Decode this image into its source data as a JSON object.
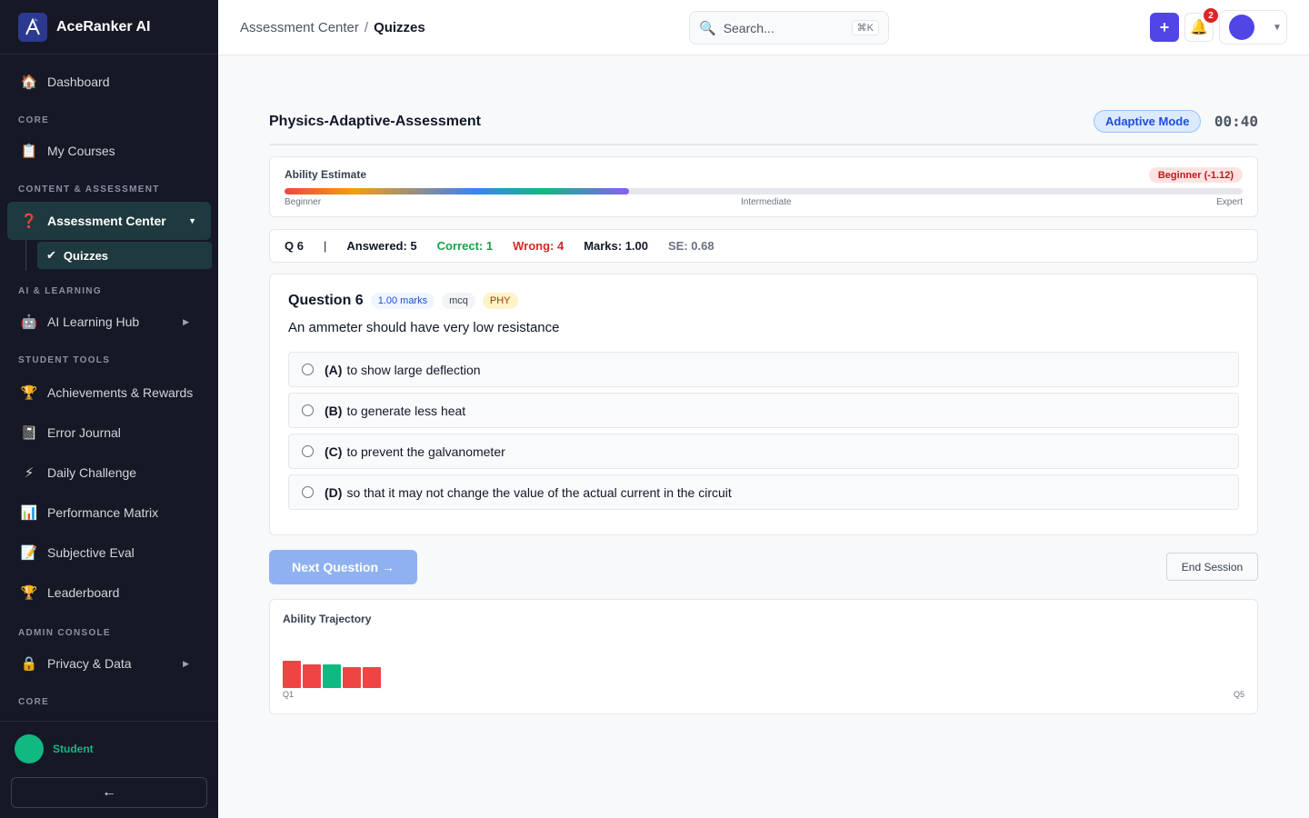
{
  "app": {
    "name": "AceRanker AI"
  },
  "sidebar": {
    "dashboard": "Dashboard",
    "section_core": "CORE",
    "my_courses": "My Courses",
    "section_content": "CONTENT & ASSESSMENT",
    "assessment_center": "Assessment Center",
    "quizzes": "Quizzes",
    "section_ai": "AI & LEARNING",
    "ai_hub": "AI Learning Hub",
    "section_tools": "STUDENT TOOLS",
    "tools": [
      {
        "label": "Achievements & Rewards",
        "icon": "🏆"
      },
      {
        "label": "Error Journal",
        "icon": "📓"
      },
      {
        "label": "Daily Challenge",
        "icon": "⚡"
      },
      {
        "label": "Performance Matrix",
        "icon": "📊"
      },
      {
        "label": "Subjective Eval",
        "icon": "📝"
      },
      {
        "label": "Leaderboard",
        "icon": "🏆"
      }
    ],
    "section_admin": "ADMIN CONSOLE",
    "privacy": "Privacy & Data",
    "section_core2": "CORE",
    "user_name": "Student",
    "collapse_icon": "←"
  },
  "topbar": {
    "breadcrumb_parent": "Assessment Center",
    "breadcrumb_sep": "/",
    "breadcrumb_current": "Quizzes",
    "search_placeholder": "Search...",
    "search_shortcut": "⌘K",
    "notification_count": "2"
  },
  "quiz": {
    "title": "Physics-Adaptive-Assessment",
    "mode": "Adaptive Mode",
    "timer": "00:40",
    "ability": {
      "label": "Ability Estimate",
      "level": "Beginner (-1.12)",
      "progress_percent": 36,
      "scale_start": "Beginner",
      "scale_mid": "Intermediate",
      "scale_end": "Expert"
    },
    "stats": {
      "question": "Q 6",
      "divider": "|",
      "answered": "Answered: 5",
      "correct": "Correct: 1",
      "wrong": "Wrong: 4",
      "marks": "Marks: 1.00",
      "se": "SE: 0.68"
    },
    "question": {
      "title": "Question 6",
      "marks": "1.00 marks",
      "type": "mcq",
      "subject": "PHY",
      "text": "An ammeter should have very low resistance",
      "options": [
        {
          "letter": "(A)",
          "text": "to show large deflection"
        },
        {
          "letter": "(B)",
          "text": "to generate less heat"
        },
        {
          "letter": "(C)",
          "text": "to prevent the galvanometer"
        },
        {
          "letter": "(D)",
          "text": "so that it may not change the value of the actual current in the circuit"
        }
      ]
    },
    "next_button": "Next Question →",
    "end_button": "End Session",
    "trajectory": {
      "title": "Ability Trajectory",
      "first_label": "Q1",
      "last_label": "Q5"
    }
  },
  "chart_data": {
    "type": "bar",
    "categories": [
      "Q1",
      "Q2",
      "Q3",
      "Q4",
      "Q5"
    ],
    "values": [
      1.0,
      0.85,
      0.85,
      0.78,
      0.78
    ],
    "results": [
      "wrong",
      "wrong",
      "correct",
      "wrong",
      "wrong"
    ],
    "colors": {
      "wrong": "#ef4444",
      "correct": "#10b981"
    }
  }
}
